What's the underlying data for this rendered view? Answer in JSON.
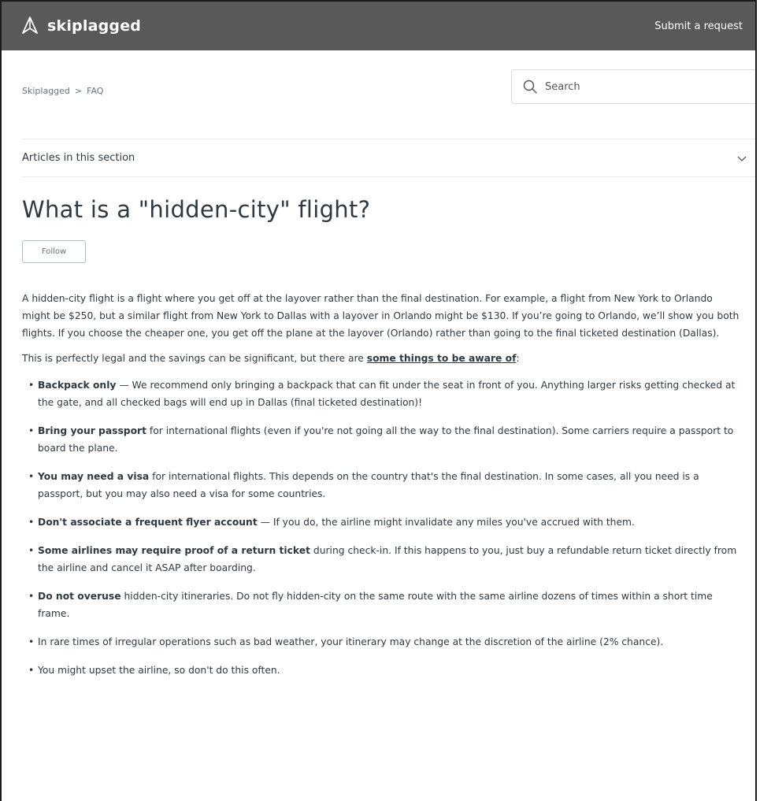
{
  "header": {
    "brand_name": "skiplagged",
    "submit_label": "Submit a request"
  },
  "breadcrumb": {
    "items": [
      "Skiplagged",
      "FAQ"
    ],
    "separator": ">"
  },
  "search": {
    "placeholder": "Search"
  },
  "section_nav": {
    "label": "Articles in this section"
  },
  "article": {
    "title": "What is a \"hidden-city\" flight?",
    "follow_label": "Follow",
    "intro": "A hidden-city flight is a flight where you get off at the layover rather than the final destination. For example, a flight from New York to Orlando might be $250, but a similar flight from New York to Dallas with a layover in Orlando might be $130. If you’re going to Orlando, we’ll show you both flights. If you choose the cheaper one, you get off the plane at the layover (Orlando) rather than going to the final ticketed destination (Dallas).",
    "legal_prefix": "This is perfectly legal and the savings can be significant, but there are ",
    "legal_link": "some things to be aware of",
    "legal_suffix": ":",
    "tips": [
      {
        "bold": "Backpack only",
        "text": " — We recommend only bringing a backpack that can fit under the seat in front of you. Anything larger risks getting checked at the gate, and all checked bags will end up in Dallas (final ticketed destination)!"
      },
      {
        "bold": "Bring your passport",
        "text": " for international flights (even if you're not going all the way to the final destination). Some carriers require a passport to board the plane."
      },
      {
        "bold": "You may need a visa",
        "text": " for international flights. This depends on the country that's the final destination. In some cases, all you need is a passport, but you may also need a visa for some countries."
      },
      {
        "bold": "Don't associate a frequent flyer account",
        "text": " — If you do, the airline might invalidate any miles you've accrued with them."
      },
      {
        "bold": "Some airlines may require proof of a return ticket",
        "text": " during check-in. If this happens to you, just buy a refundable return ticket directly from the airline and cancel it ASAP after boarding."
      },
      {
        "bold": "Do not overuse",
        "text": " hidden-city itineraries. Do not fly hidden-city on the same route with the same airline dozens of times within a short time frame."
      },
      {
        "bold": "",
        "text": "In rare times of irregular operations such as bad weather, your itinerary may change at the discretion of the airline (2% chance)."
      },
      {
        "bold": "",
        "text": "You might upset the airline, so don't do this often."
      }
    ]
  },
  "icons": {
    "logo": "paper-plane-icon",
    "search": "search-icon",
    "toggle": "chevron-down-icon"
  },
  "colors": {
    "header_bg": "#595959",
    "header_text": "#ffffff",
    "body_text": "#2f3941",
    "muted_text": "#68737d",
    "border": "#d8dcde"
  }
}
